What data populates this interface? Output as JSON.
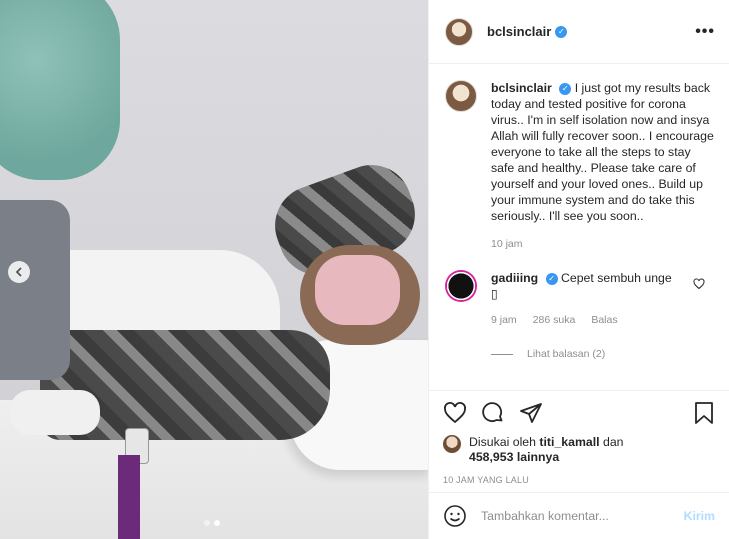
{
  "post": {
    "username": "bclsinclair",
    "more_label": "•••",
    "carousel": {
      "total": 2,
      "active": 2
    }
  },
  "caption": {
    "username": "bclsinclair",
    "text": "I just got my results back today and tested positive for corona virus.. I'm in self isolation now and insya Allah will fully recover soon.. I encourage everyone to take all the steps to stay safe and healthy.. Please take care of yourself and your loved ones.. Build up your immune system and do take this seriously.. I'll see you soon..",
    "time": "10 jam"
  },
  "comment": {
    "username": "gadiiing",
    "text": "Cepet sembuh unge",
    "emoji": "▯",
    "time": "9 jam",
    "likes": "286 suka",
    "reply_label": "Balas",
    "view_replies": "Lihat balasan (2)"
  },
  "likes": {
    "prefix": "Disukai oleh",
    "user": "titi_kamall",
    "and": "dan",
    "count": "458,953 lainnya"
  },
  "timestamp": "10 JAM YANG LALU",
  "add_comment": {
    "placeholder": "Tambahkan komentar...",
    "post_label": "Kirim"
  },
  "icons": {
    "like": "heart-icon",
    "comment": "comment-icon",
    "share": "share-icon",
    "save": "bookmark-icon",
    "emoji": "smiley-icon",
    "verified": "verified-badge-icon"
  },
  "colors": {
    "verified": "#3897f0",
    "post_button_disabled": "#b3dbff",
    "muted_text": "#8e8e8e"
  }
}
